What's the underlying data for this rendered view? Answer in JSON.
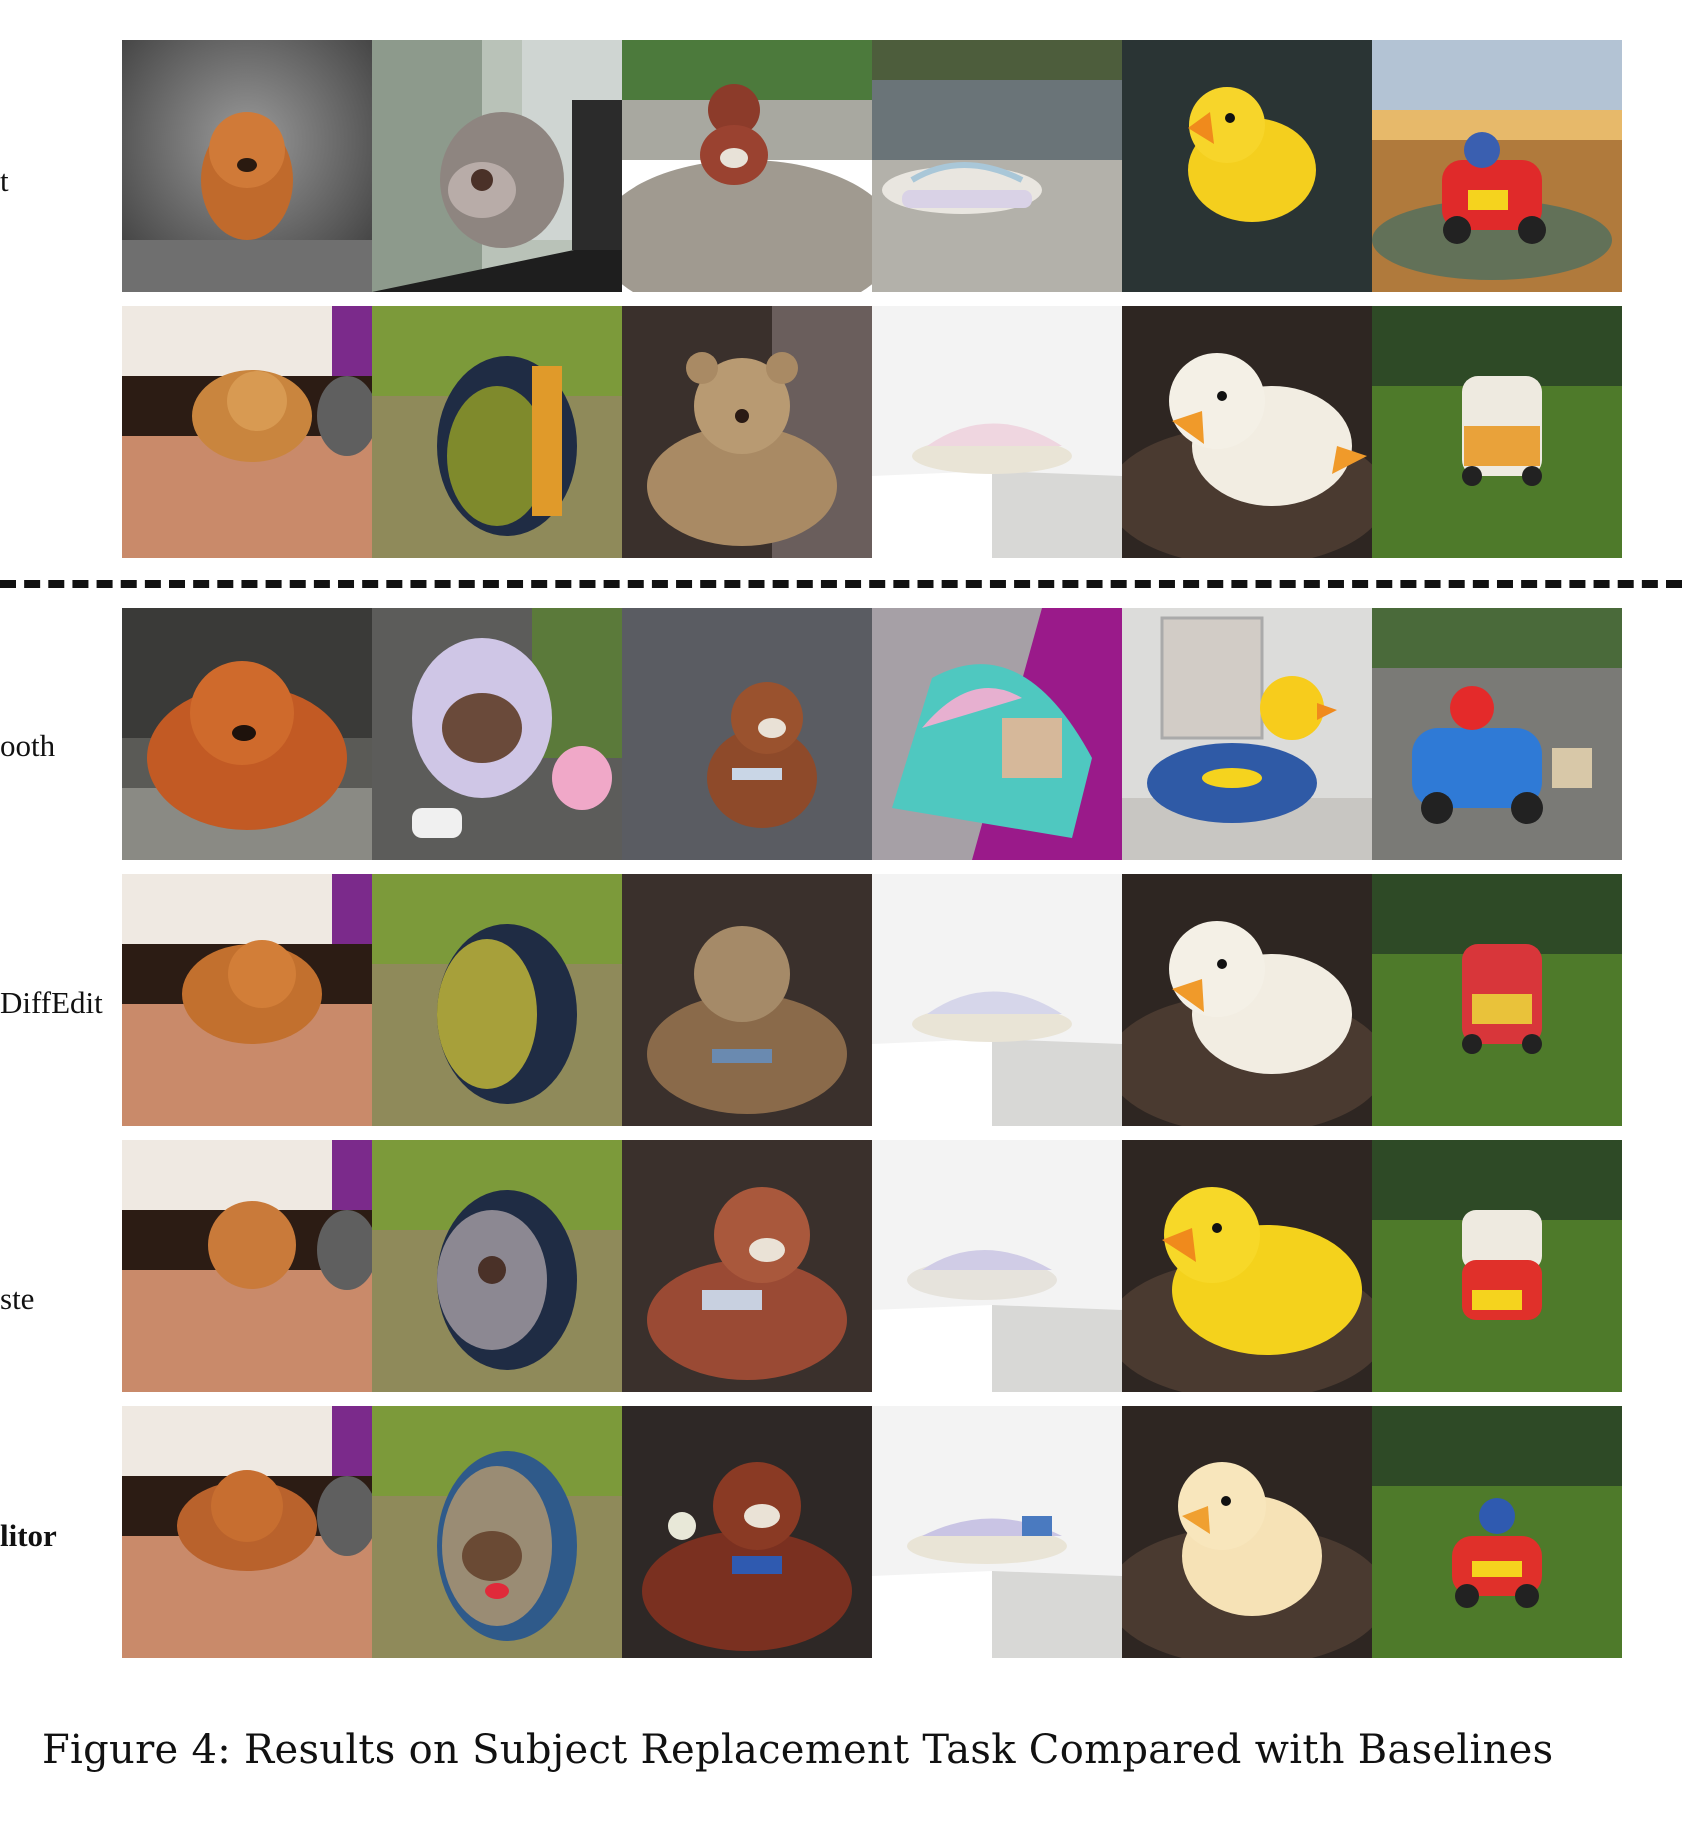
{
  "rows": [
    {
      "label": "t",
      "bold": false
    },
    {
      "label": "",
      "bold": false
    },
    {
      "label": "ooth",
      "bold": false
    },
    {
      "label": "DiffEdit",
      "bold": false
    },
    {
      "label": "ste",
      "bold": false
    },
    {
      "label": "litor",
      "bold": true
    }
  ],
  "columns": [
    "chow-chow-dog",
    "dog-backpack",
    "teddy-bear",
    "sneaker",
    "rubber-duck",
    "toy-car"
  ],
  "caption": "Figure 4: Results on Subject Replacement Task Compared with Baselines"
}
